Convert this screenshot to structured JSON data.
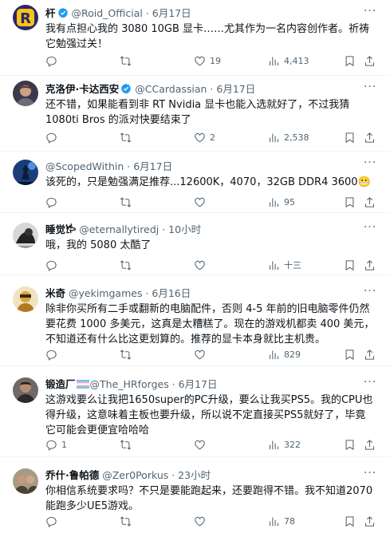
{
  "tweets": [
    {
      "name": "杆",
      "handle": "@Roid_Official",
      "time": "6月17日",
      "verified": true,
      "text": "我有点担心我的 3080 10GB 显卡……尤其作为一名内容创作者。祈祷它勉强过关！",
      "replies": "",
      "retweets": "",
      "likes": "19",
      "views": "4,413"
    },
    {
      "name": "克洛伊·卡达西安",
      "handle": "@CCardassian",
      "time": "6月17日",
      "verified": true,
      "text": "还不错，如果能看到非 RT Nvidia 显卡也能入选就好了，不过我猜 1080ti Bros 的派对快要结束了",
      "replies": "",
      "retweets": "",
      "likes": "2",
      "views": "2,538"
    },
    {
      "name": "",
      "handle": "@ScopedWithin",
      "time": "6月17日",
      "verified": false,
      "text": "该死的，只是勉强满足推荐...12600K，4070，32GB DDR4 3600😬",
      "replies": "",
      "retweets": "",
      "likes": "",
      "views": "95"
    },
    {
      "name": "睡觉𐂂",
      "handle": "@eternallytiredj",
      "time": "10小时",
      "verified": false,
      "text": "哦，我的 5080 太酷了",
      "replies": "",
      "retweets": "",
      "likes": "",
      "views": "十三"
    },
    {
      "name": "米奇",
      "handle": "@yekimgames",
      "time": "6月16日",
      "verified": false,
      "text": "除非你买所有二手或翻新的电脑配件，否则 4-5 年前的旧电脑零件仍然要花费 1000 多美元，这真是太糟糕了。现在的游戏机都卖 400 美元，不知道还有什么比这更划算的。推荐的显卡本身就比主机贵。",
      "replies": "",
      "retweets": "",
      "likes": "",
      "views": "829"
    },
    {
      "name": "锻造厂",
      "handle": "@The_HRforges",
      "time": "6月17日",
      "verified": false,
      "flag": true,
      "text": "这游戏要么让我把1650super的PC升级，要么让我买PS5。我的CPU也得升级，这意味着主板也要升级，所以说不定直接买PS5就好了，毕竟它可能会更便宜哈哈哈",
      "replies": "1",
      "retweets": "",
      "likes": "",
      "views": "322"
    },
    {
      "name": "乔什·鲁帕德",
      "handle": "@Zer0Porkus",
      "time": "23小时",
      "verified": false,
      "text": "你相信系统要求吗？不只是要能跑起来，还要跑得不错。我不知道2070能跑多少UE5游戏。",
      "replies": "",
      "retweets": "",
      "likes": "",
      "views": "78"
    }
  ],
  "ui": {
    "separator": " · ",
    "more_glyph": "···",
    "accent_color": "#1d9bf0",
    "icons": [
      "more-icon",
      "reply-icon",
      "retweet-icon",
      "like-icon",
      "views-icon",
      "bookmark-icon",
      "share-icon",
      "verified-badge-icon",
      "trans-flag-icon"
    ]
  }
}
